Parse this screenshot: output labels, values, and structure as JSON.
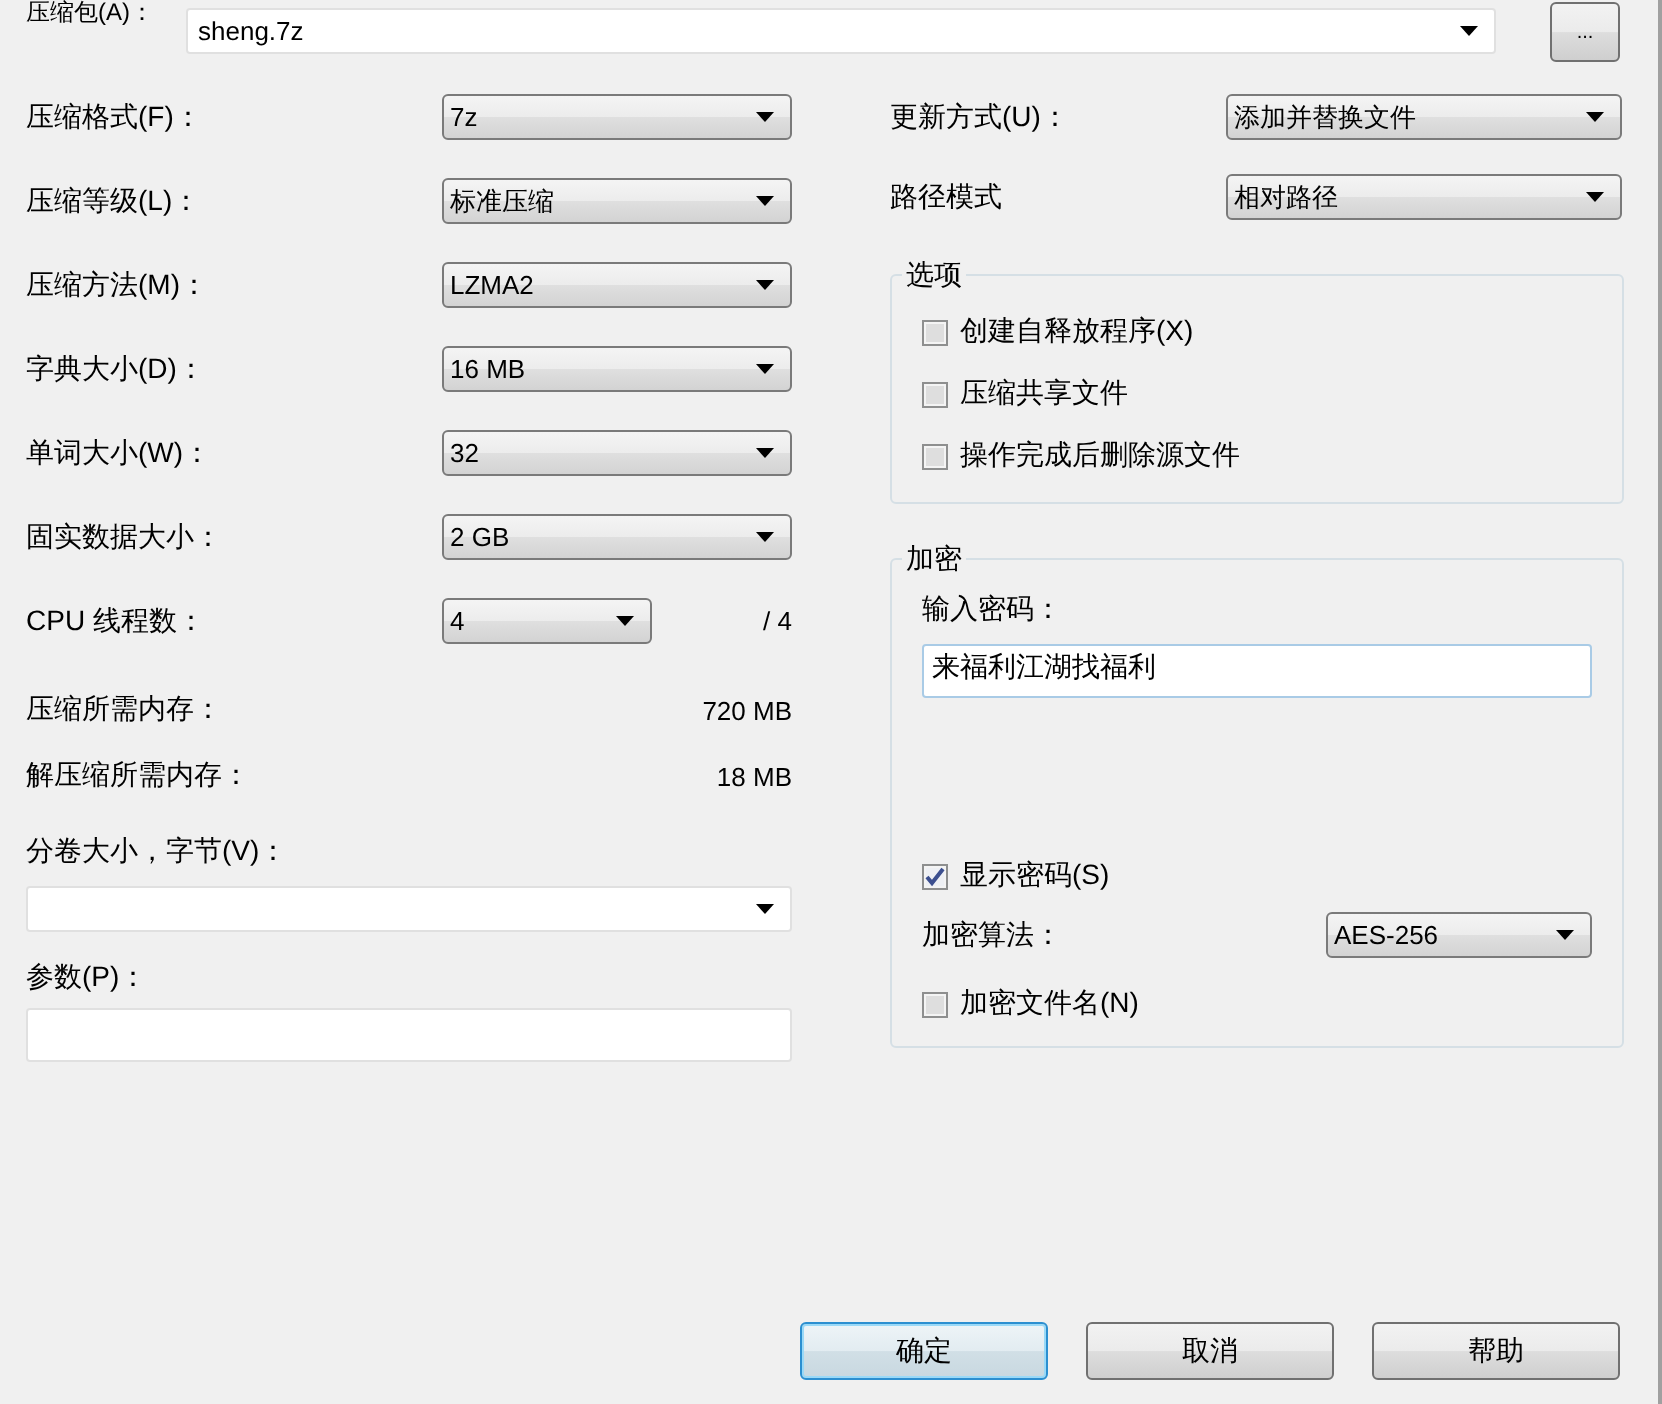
{
  "archive": {
    "label": "压缩包(A)：",
    "value": "sheng.7z",
    "browse_button": "..."
  },
  "left_settings": [
    {
      "label": "压缩格式(F)：",
      "value": "7z"
    },
    {
      "label": "压缩等级(L)：",
      "value": "标准压缩"
    },
    {
      "label": "压缩方法(M)：",
      "value": "LZMA2"
    },
    {
      "label": "字典大小(D)：",
      "value": "16 MB"
    },
    {
      "label": "单词大小(W)：",
      "value": "32"
    },
    {
      "label": "固实数据大小：",
      "value": "2 GB"
    }
  ],
  "cpu_threads": {
    "label": "CPU 线程数：",
    "value": "4",
    "max": "/ 4"
  },
  "memory": [
    {
      "label": "压缩所需内存：",
      "value": "720 MB"
    },
    {
      "label": "解压缩所需内存：",
      "value": "18 MB"
    }
  ],
  "volume_size": {
    "label": "分卷大小，字节(V)："
  },
  "parameters": {
    "label": "参数(P)："
  },
  "right_settings": [
    {
      "label": "更新方式(U)：",
      "value": "添加并替换文件"
    },
    {
      "label": "路径模式",
      "value": "相对路径"
    }
  ],
  "options": {
    "title": "选项",
    "items": [
      {
        "label": "创建自释放程序(X)",
        "checked": false
      },
      {
        "label": "压缩共享文件",
        "checked": false
      },
      {
        "label": "操作完成后删除源文件",
        "checked": false
      }
    ]
  },
  "encryption": {
    "title": "加密",
    "password_label": "输入密码：",
    "password": "来福利江湖找福利",
    "show_password": {
      "label": "显示密码(S)",
      "checked": true
    },
    "method_label": "加密算法：",
    "method": "AES-256",
    "encrypt_names": {
      "label": "加密文件名(N)",
      "checked": false
    }
  },
  "buttons": [
    {
      "label": "确定",
      "default": true
    },
    {
      "label": "取消",
      "default": false
    },
    {
      "label": "帮助",
      "default": false
    }
  ]
}
